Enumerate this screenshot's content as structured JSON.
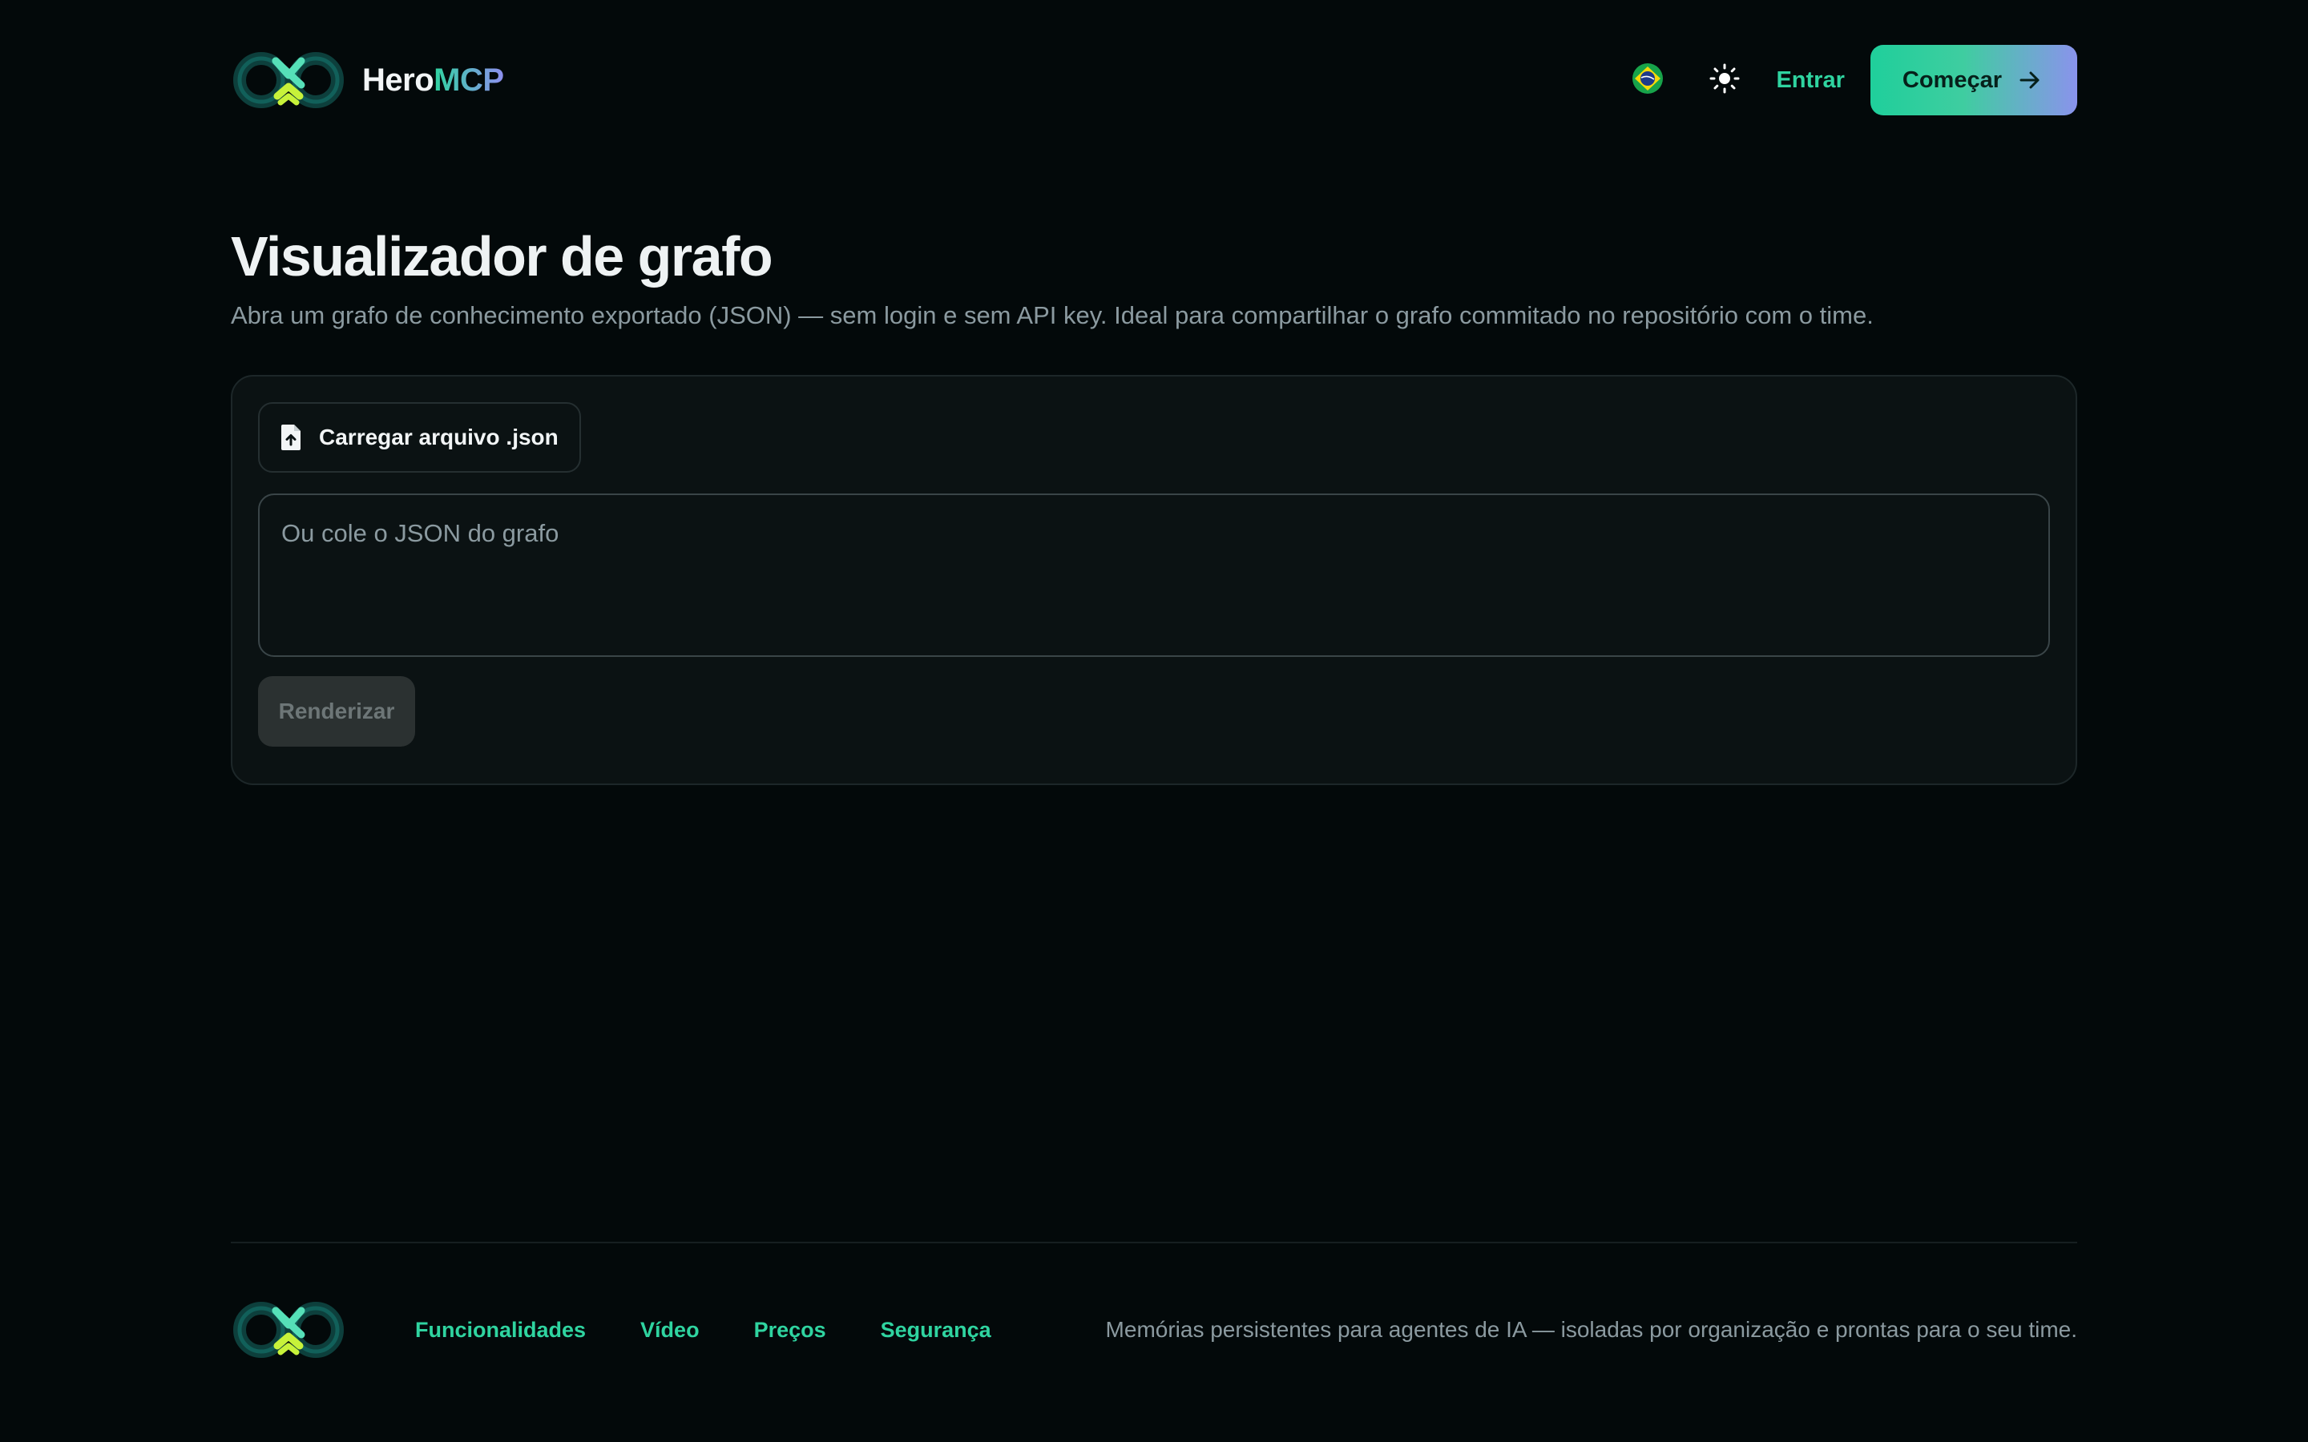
{
  "header": {
    "brand_part1": "Hero",
    "brand_part2": "MCP",
    "language_flag": "brazil-flag-icon",
    "theme_icon": "sun-icon",
    "login_label": "Entrar",
    "cta_label": "Começar"
  },
  "main": {
    "title": "Visualizador de grafo",
    "subtitle": "Abra um grafo de conhecimento exportado (JSON) — sem login e sem API key. Ideal para compartilhar o grafo commitado no repositório com o time.",
    "upload_label": "Carregar arquivo .json",
    "json_placeholder": "Ou cole o JSON do grafo",
    "json_value": "",
    "render_label": "Renderizar",
    "render_enabled": false
  },
  "footer": {
    "links": [
      "Funcionalidades",
      "Vídeo",
      "Preços",
      "Segurança"
    ],
    "tagline": "Memórias persistentes para agentes de IA — isoladas por organização e prontas para o seu time."
  },
  "colors": {
    "background": "#03090a",
    "accent": "#2fd4a0",
    "accent_gradient_end": "#8a93ec",
    "card": "#0b1213",
    "muted_text": "#8b9aa0"
  }
}
